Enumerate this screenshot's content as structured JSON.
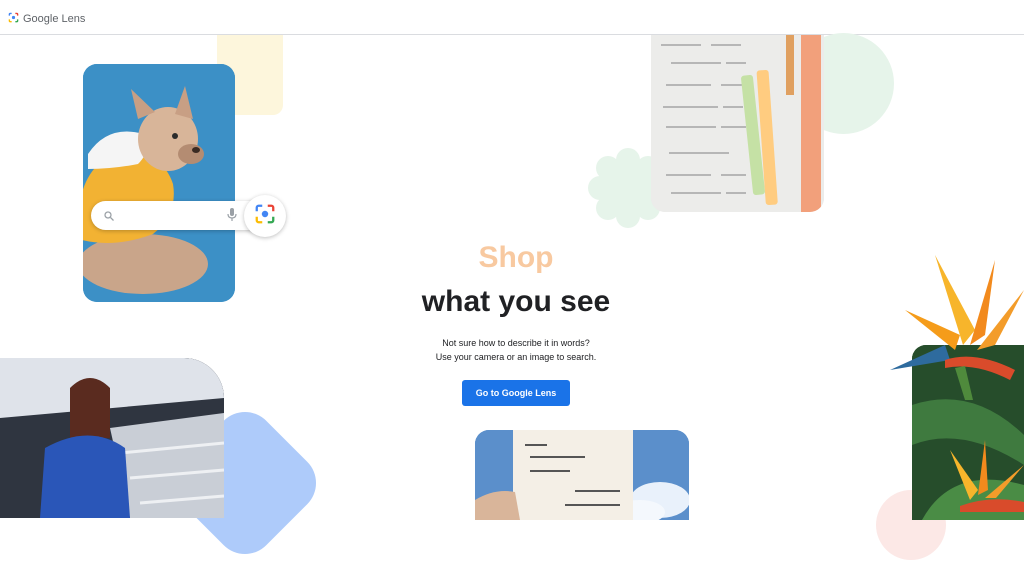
{
  "header": {
    "title": "Google Lens"
  },
  "hero": {
    "accent": "Shop",
    "title": "what you see",
    "subtitle_line1": "Not sure how to describe it in words?",
    "subtitle_line2": "Use your camera or an image to search.",
    "cta_label": "Go to Google Lens"
  },
  "colors": {
    "accent_peach": "#f8c9a0",
    "cta_blue": "#1a73e8"
  },
  "icons": [
    "google-lens-logo-icon",
    "search-icon",
    "mic-icon",
    "camera-lens-icon"
  ]
}
